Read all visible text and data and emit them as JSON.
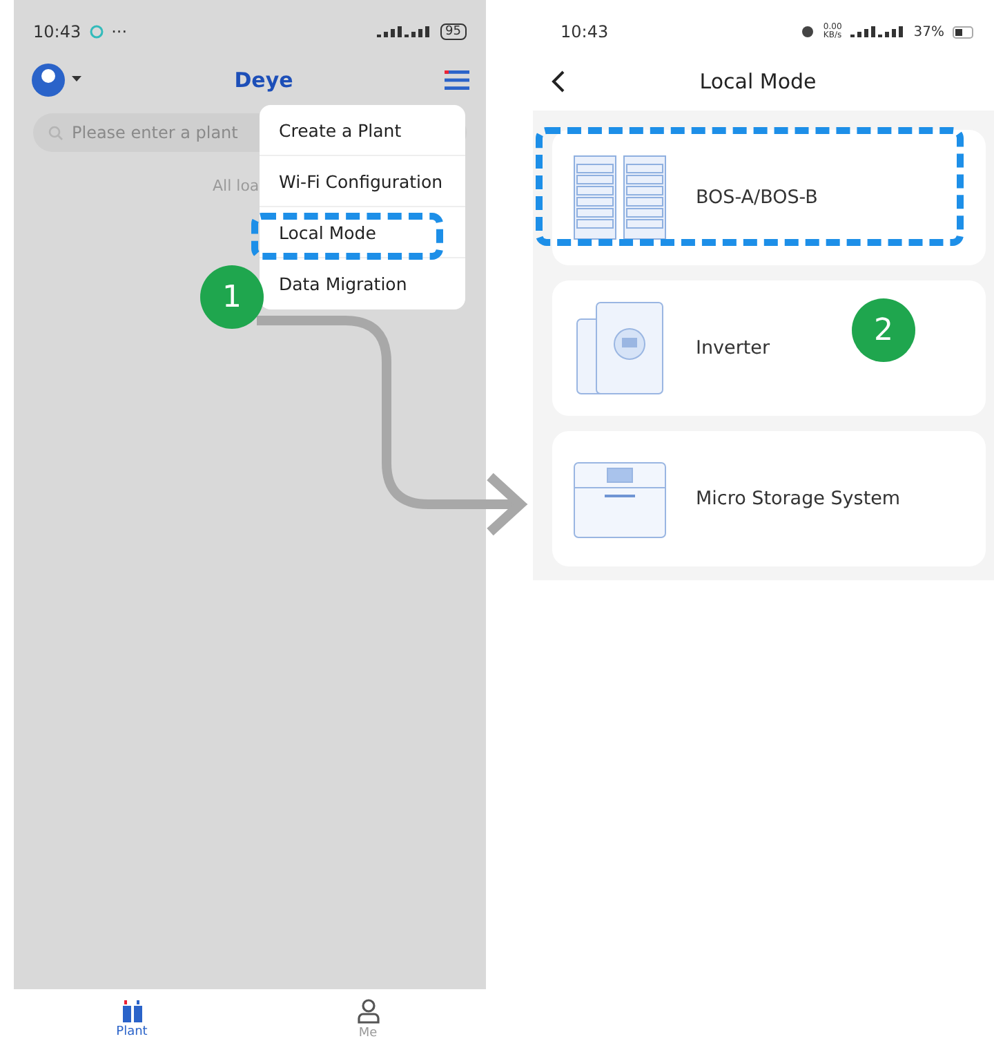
{
  "left_screen": {
    "status_bar": {
      "time": "10:43",
      "dots": "···",
      "battery": "95"
    },
    "header": {
      "logo": "Deye"
    },
    "search": {
      "placeholder": "Please enter a plant"
    },
    "list_message": "All loa",
    "menu": [
      {
        "label": "Create a Plant",
        "highlighted": false
      },
      {
        "label": "Wi-Fi Configuration",
        "highlighted": false
      },
      {
        "label": "Local Mode",
        "highlighted": true
      },
      {
        "label": "Data Migration",
        "highlighted": false
      }
    ],
    "tab_bar": [
      {
        "label": "Plant",
        "kind": "plant",
        "selected": true
      },
      {
        "label": "Me",
        "kind": "me",
        "selected": false
      }
    ]
  },
  "right_screen": {
    "status_bar": {
      "time": "10:43",
      "speed": "0.00",
      "speed_unit": "KB/s",
      "battery": "37%"
    },
    "title": "Local Mode",
    "devices": [
      {
        "name": "BOS-A/BOS-B",
        "kind": "rack",
        "highlighted": true
      },
      {
        "name": "Inverter",
        "kind": "inverter",
        "highlighted": false
      },
      {
        "name": "Micro Storage System",
        "kind": "storage",
        "highlighted": false
      }
    ]
  },
  "step_badges": [
    "1",
    "2"
  ]
}
